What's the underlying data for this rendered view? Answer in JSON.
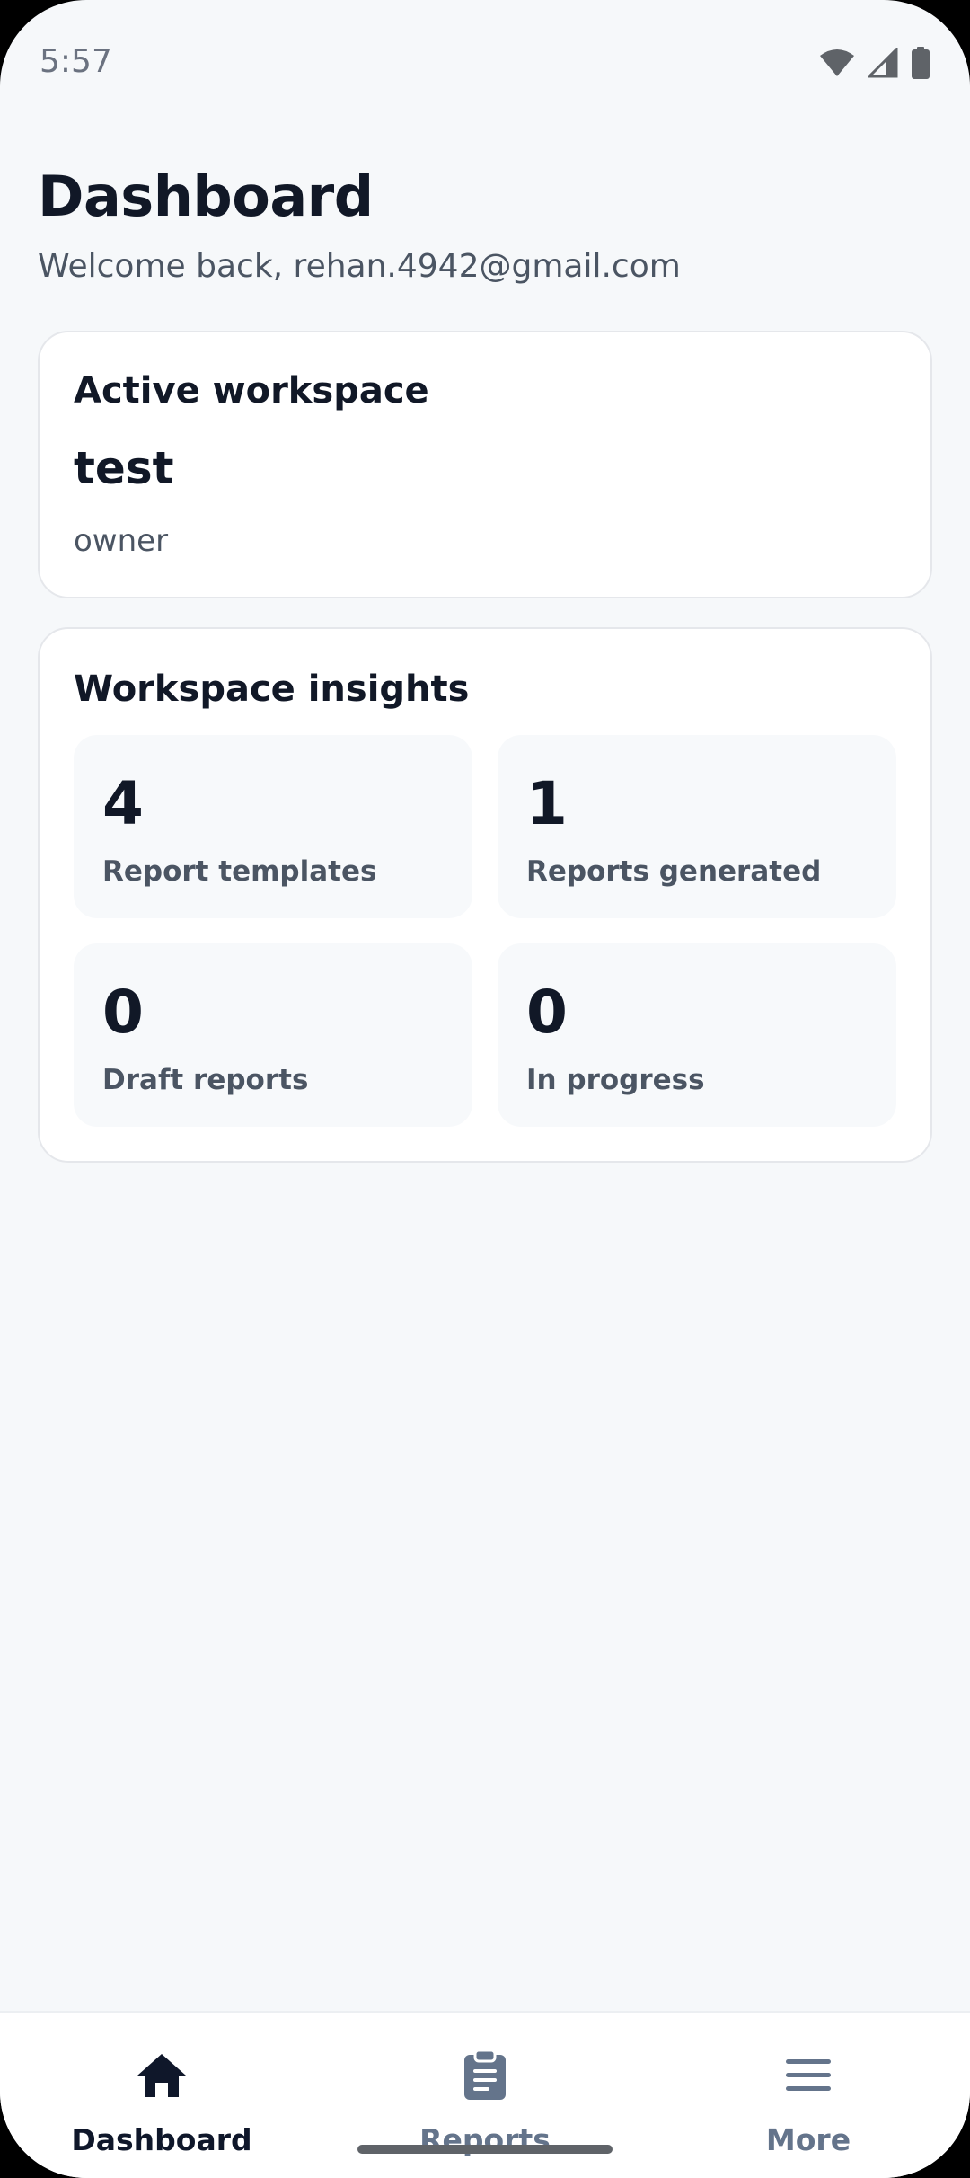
{
  "status_bar": {
    "time": "5:57",
    "icons": [
      "wifi-icon",
      "cellular-signal-icon",
      "battery-icon"
    ]
  },
  "header": {
    "title": "Dashboard",
    "welcome": "Welcome back, rehan.4942@gmail.com"
  },
  "workspace_card": {
    "heading": "Active workspace",
    "name": "test",
    "role": "owner"
  },
  "insights_card": {
    "heading": "Workspace insights",
    "stats": [
      {
        "value": "4",
        "label": "Report templates"
      },
      {
        "value": "1",
        "label": "Reports generated"
      },
      {
        "value": "0",
        "label": "Draft reports"
      },
      {
        "value": "0",
        "label": "In progress"
      }
    ]
  },
  "bottom_nav": {
    "items": [
      {
        "label": "Dashboard",
        "icon": "home-icon",
        "active": true
      },
      {
        "label": "Reports",
        "icon": "clipboard-icon",
        "active": false
      },
      {
        "label": "More",
        "icon": "menu-icon",
        "active": false
      }
    ]
  },
  "colors": {
    "background": "#f6f8fa",
    "card": "#ffffff",
    "text_primary": "#111827",
    "text_secondary": "#4b5563",
    "nav_active": "#0f172a",
    "nav_inactive": "#64748b"
  }
}
